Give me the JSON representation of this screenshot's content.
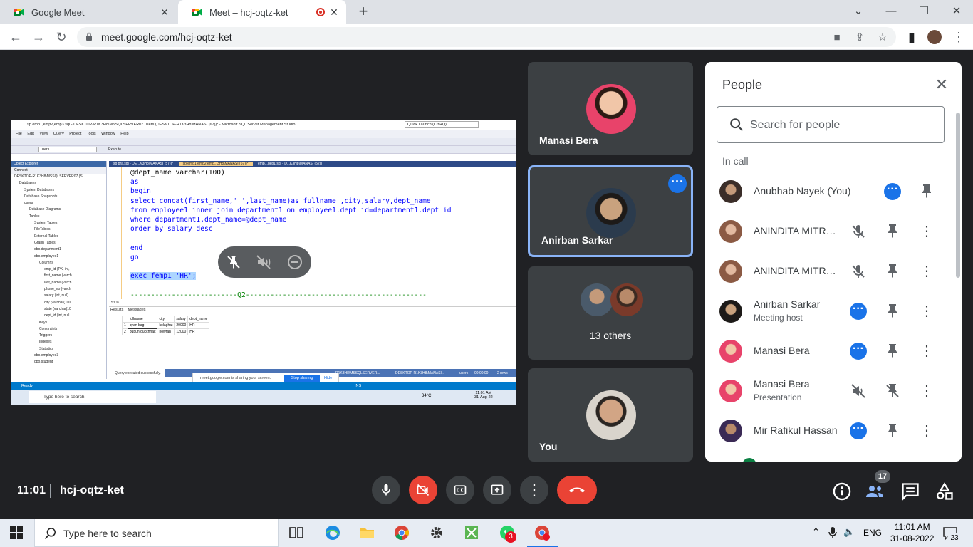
{
  "browser": {
    "tabs": [
      {
        "title": "Google Meet",
        "active": false
      },
      {
        "title": "Meet – hcj-oqtz-ket",
        "active": true
      }
    ],
    "url": "meet.google.com/hcj-oqtz-ket"
  },
  "shared_screen": {
    "window_title": "sp emp1,emp2,emp3.sql - DESKTOP-R1K3H8\\MSSQLSERVER07.users (DESKTOP-R1K3H8\\MANASI (67))* - Microsoft SQL Server Management Studio",
    "quick_launch": "Quick Launch (Ctrl+Q)",
    "menu": "File Edit View Query Project Tools Window Help",
    "db_select": "users",
    "execute_label": "Execute",
    "object_explorer_title": "Object Explorer",
    "connect_label": "Connect",
    "tree": [
      "DESKTOP-R1K3H8\\MSSQLSERVER07 (S",
      "Databases",
      "System Databases",
      "Database Snapshots",
      "users",
      "Database Diagrams",
      "Tables",
      "System Tables",
      "FileTables",
      "External Tables",
      "Graph Tables",
      "dbo.department1",
      "dbo.employee1",
      "Columns",
      "emp_id (PK, int,",
      "first_name (varch",
      "last_name (varch",
      "phone_no (varch",
      "salary (int, null)",
      "city (varchar(100",
      "state (varchar(10",
      "dept_id (int, null",
      "Keys",
      "Constraints",
      "Triggers",
      "Indexes",
      "Statistics",
      "dbo.employee3",
      "dbo.student"
    ],
    "editor_tabs": [
      "sp pra.sql - DE...K3H8\\MANASI (57))*",
      "sp emp1,emp2,emp...3H8\\MANASI (67))*",
      "emp1,dep1.sql - D...K3H8\\MANASI (52))"
    ],
    "code_lines": [
      "@dept_name varchar(100)",
      "as",
      "begin",
      "select concat(first_name,' ',last_name)as fullname ,city,salary,dept_name",
      "from employee1 inner join department1 on employee1.dept_id=department1.dept_id",
      "where department1.dept_name=@dept_name",
      "order by salary desc",
      "",
      "end",
      "go",
      "",
      "exec femp1 'HR';",
      "",
      "--------------------------Q2--------------------------------------------"
    ],
    "zoom": "153 %",
    "results_tab": "Results",
    "messages_tab": "Messages",
    "result_columns": [
      "fullname",
      "city",
      "salary",
      "dept_name"
    ],
    "result_rows": [
      [
        "1",
        "ayan bag",
        "kolaghat",
        "20000",
        "HR"
      ],
      [
        "2",
        "bubun gucchhait",
        "nowrah",
        "12000",
        "HR"
      ]
    ],
    "query_status": "Query executed successfully.",
    "status_server": "R1K3H8\\MSSQLSERVER...",
    "status_user": "DESKTOP-R1K3H8\\MANASI...",
    "status_db": "users",
    "status_time": "00:00:00",
    "status_rows": "2 rows",
    "sharing_msg": "meet.google.com is sharing your screen.",
    "stop_sharing": "Stop sharing",
    "hide": "Hide",
    "ready": "Ready",
    "ins": "INS",
    "inner_search": "Type here to search",
    "inner_temp": "34°C",
    "inner_time": "11:01 AM",
    "inner_date": "31-Aug-22"
  },
  "tiles": [
    {
      "name": "Manasi Bera"
    },
    {
      "name": "Anirban Sarkar"
    },
    {
      "name": "13 others"
    },
    {
      "name": "You"
    }
  ],
  "people_panel": {
    "title": "People",
    "search_placeholder": "Search for people",
    "section": "In call",
    "participants": [
      {
        "name": "Anubhab Nayek (You)",
        "sub": ""
      },
      {
        "name": "ANINDITA MITRA ...",
        "sub": ""
      },
      {
        "name": "ANINDITA MITRA ...",
        "sub": ""
      },
      {
        "name": "Anirban Sarkar",
        "sub": "Meeting host"
      },
      {
        "name": "Manasi Bera",
        "sub": ""
      },
      {
        "name": "Manasi Bera",
        "sub": "Presentation"
      },
      {
        "name": "Mir Rafikul Hassan",
        "sub": ""
      }
    ]
  },
  "bottom_bar": {
    "time": "11:01",
    "meeting_code": "hcj-oqtz-ket",
    "people_count": "17"
  },
  "taskbar": {
    "search_placeholder": "Type here to search",
    "language": "ENG",
    "time": "11:01 AM",
    "date": "31-08-2022",
    "notification_count": "23",
    "whatsapp_badge": "3"
  },
  "colors": {
    "meet_bg": "#202124",
    "tile_bg": "#3c4043",
    "accent_blue": "#1a73e8",
    "leave_red": "#ea4335",
    "active_border": "#8ab4f8"
  }
}
